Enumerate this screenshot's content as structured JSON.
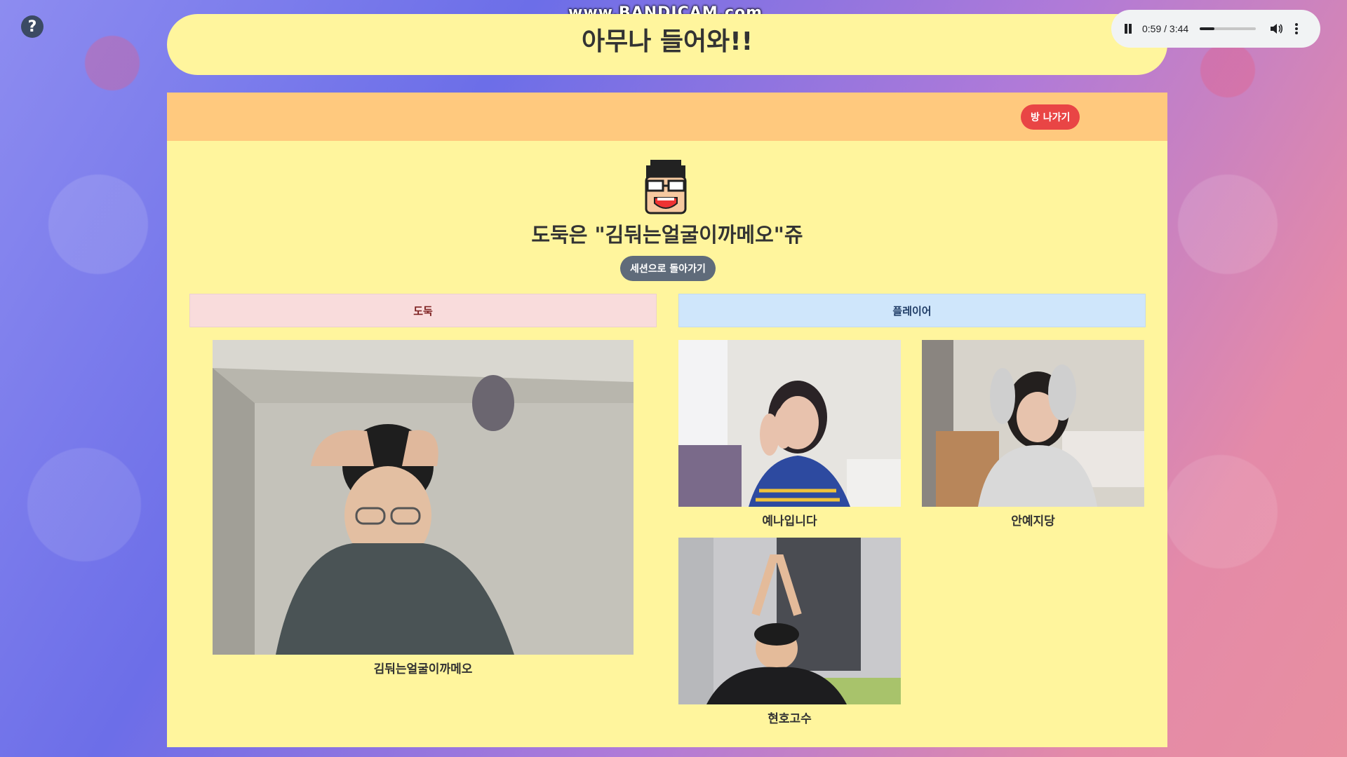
{
  "watermark": "www.BANDICAM.com",
  "title": "아무나 들어와!!",
  "help_icon": "?",
  "audio": {
    "time": "0:59 / 3:44",
    "progress": 0.26,
    "icons": [
      "pause-icon",
      "volume-icon",
      "more-vert-icon"
    ]
  },
  "header": {
    "leave_label": "방 나가기"
  },
  "thief_announcement": "도둑은 \"김둬는얼굴이까메오\"쥬",
  "back_label": "세션으로 돌아가기",
  "sections": {
    "thief": "도둑",
    "players": "플레이어"
  },
  "thief_video": {
    "name": "김둬는얼굴이까메오"
  },
  "player_videos": [
    {
      "name": "예나입니다"
    },
    {
      "name": "안예지당"
    },
    {
      "name": "현호고수"
    }
  ],
  "colors": {
    "panel": "#fff59d",
    "header": "#ffc97e",
    "leave_button": "#e94545",
    "back_button": "#5f6b7a",
    "thief_section": "#f9dcdc",
    "player_section": "#cfe6fb"
  }
}
